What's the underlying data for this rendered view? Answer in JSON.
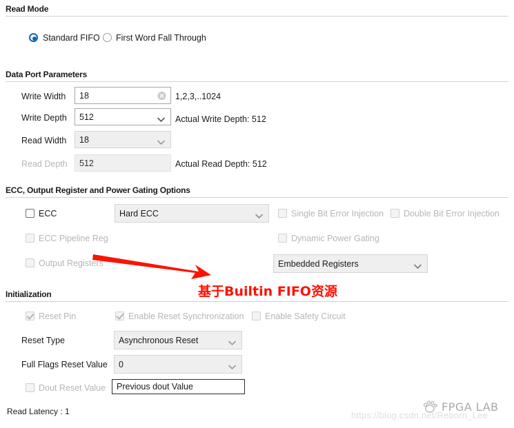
{
  "sections": {
    "read_mode": {
      "title": "Read Mode"
    },
    "data_port": {
      "title": "Data Port Parameters"
    },
    "ecc": {
      "title": "ECC, Output Register and Power Gating Options"
    },
    "init": {
      "title": "Initialization"
    }
  },
  "read_mode": {
    "options": [
      {
        "label": "Standard FIFO",
        "selected": true
      },
      {
        "label": "First Word Fall Through",
        "selected": false
      }
    ]
  },
  "data_port": {
    "write_width": {
      "label": "Write Width",
      "value": "18",
      "hint": "1,2,3,..1024",
      "clear_icon": "clear-circle-icon"
    },
    "write_depth": {
      "label": "Write Depth",
      "value": "512",
      "actual": "Actual Write Depth: 512"
    },
    "read_width": {
      "label": "Read Width",
      "value": "18"
    },
    "read_depth": {
      "label": "Read Depth",
      "value": "512",
      "actual": "Actual Read Depth: 512"
    }
  },
  "ecc": {
    "ecc_checkbox": {
      "label": "ECC",
      "checked": false,
      "enabled": true
    },
    "ecc_mode": {
      "value": "Hard ECC"
    },
    "single_bit": {
      "label": "Single Bit Error Injection",
      "checked": false,
      "enabled": false
    },
    "double_bit": {
      "label": "Double Bit Error Injection",
      "checked": false,
      "enabled": false
    },
    "pipeline_reg": {
      "label": "ECC Pipeline Reg",
      "checked": false,
      "enabled": false
    },
    "dynamic_power": {
      "label": "Dynamic Power Gating",
      "checked": false,
      "enabled": false
    },
    "output_registers": {
      "label": "Output Registers",
      "checked": false,
      "enabled": false
    },
    "register_mode": {
      "value": "Embedded Registers"
    }
  },
  "init": {
    "reset_pin": {
      "label": "Reset Pin",
      "checked": true,
      "enabled": false
    },
    "reset_sync": {
      "label": "Enable Reset Synchronization",
      "checked": true,
      "enabled": false
    },
    "safety_circuit": {
      "label": "Enable Safety Circuit",
      "checked": false,
      "enabled": false
    },
    "reset_type": {
      "label": "Reset Type",
      "value": "Asynchronous Reset"
    },
    "full_flags": {
      "label": "Full Flags Reset Value",
      "value": "0"
    },
    "dout_reset": {
      "label": "Dout Reset Value",
      "checked": false,
      "enabled": false,
      "value": "Previous dout Value"
    }
  },
  "footer": {
    "read_latency": "Read Latency : 1"
  },
  "annotation": {
    "text": "基于Builtin FIFO资源",
    "color": "#ff1100"
  },
  "watermark": {
    "url": "https://blog.csdn.net/Reborn_Lee",
    "brand": "FPGA LAB",
    "logo_icon": "paw-logo-icon"
  },
  "colors": {
    "radio_accent": "#1464b4",
    "annotation_red": "#ff1100",
    "arrow_red": "#fa1400",
    "rule": "#d0d0d0"
  }
}
